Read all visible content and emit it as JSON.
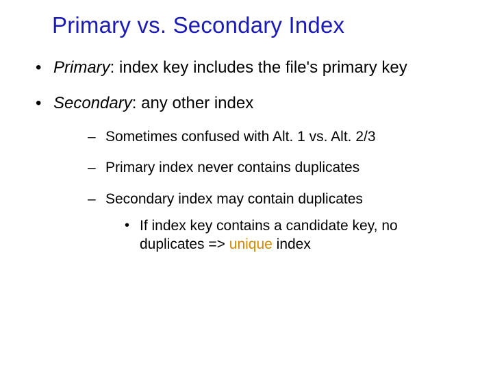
{
  "title": "Primary vs. Secondary Index",
  "bullets": [
    {
      "term": "Primary",
      "sep": ":  ",
      "rest": "index key includes the file's primary key"
    },
    {
      "term": "Secondary",
      "sep": ":  ",
      "rest": "any other index"
    }
  ],
  "sub": [
    "Sometimes confused with Alt. 1 vs. Alt. 2/3",
    "Primary index never contains duplicates",
    "Secondary index may contain duplicates"
  ],
  "subsub": {
    "pre": "If index key contains a candidate key, no duplicates => ",
    "accent": "unique",
    "post": " index"
  }
}
